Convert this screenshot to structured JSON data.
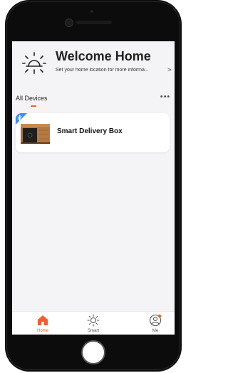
{
  "header": {
    "title": "Welcome Home",
    "subtitle": "Set your home location for more informa...",
    "chevron": ">"
  },
  "devices": {
    "tab_label": "All Devices",
    "more": "•••",
    "items": [
      {
        "name": "Smart Delivery Box",
        "icon": "bluetooth-icon"
      }
    ]
  },
  "tabbar": {
    "items": [
      {
        "label": "Home",
        "icon": "home-icon",
        "active": true
      },
      {
        "label": "Smart",
        "icon": "sun-icon",
        "active": false
      },
      {
        "label": "Me",
        "icon": "profile-icon",
        "active": false
      }
    ]
  },
  "colors": {
    "accent": "#ff5a28",
    "bluetooth": "#3b8cf5",
    "background": "#f4f4f6"
  }
}
